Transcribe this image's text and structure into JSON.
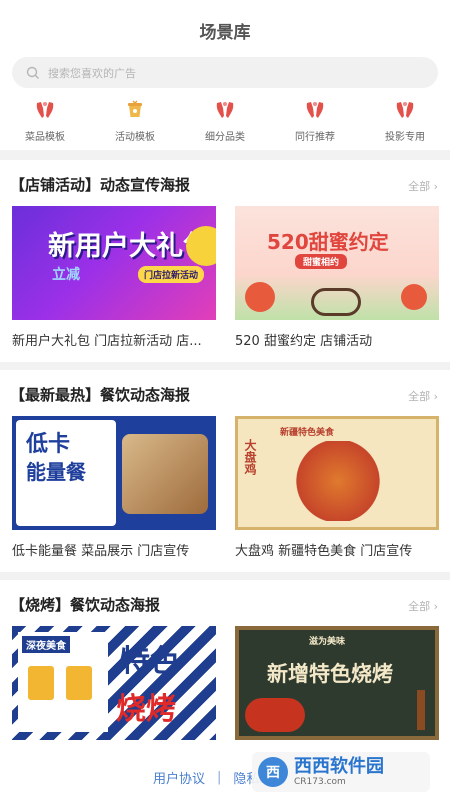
{
  "header": {
    "title": "场景库"
  },
  "search": {
    "placeholder": "搜索您喜欢的广告",
    "icon": "search-icon"
  },
  "categories": [
    {
      "label": "菜品模板",
      "icon": "hands-icon",
      "color": "#e4514a"
    },
    {
      "label": "活动模板",
      "icon": "cup-icon",
      "color": "#e8a23a"
    },
    {
      "label": "细分品类",
      "icon": "hands-icon",
      "color": "#e4514a"
    },
    {
      "label": "同行推荐",
      "icon": "hands-icon",
      "color": "#e4514a"
    },
    {
      "label": "投影专用",
      "icon": "hands-icon",
      "color": "#e4514a"
    }
  ],
  "sections": [
    {
      "title": "【店铺活动】动态宣传海报",
      "more": "全部",
      "cards": [
        {
          "caption": "新用户大礼包 门店拉新活动 店...",
          "poster_text": "新用户大礼包",
          "poster_sub": "立减",
          "poster_badge": "门店拉新活动"
        },
        {
          "caption": "520 甜蜜约定 店铺活动",
          "poster_text": "520甜蜜约定",
          "poster_sub": "甜蜜相约"
        }
      ]
    },
    {
      "title": "【最新最热】餐饮动态海报",
      "more": "全部",
      "cards": [
        {
          "caption": "低卡能量餐 菜品展示 门店宣传",
          "poster_text": "低卡",
          "poster_sub": "能量餐"
        },
        {
          "caption": "大盘鸡 新疆特色美食 门店宣传",
          "poster_text": "新疆特色美食",
          "poster_sub": "大盘鸡"
        }
      ]
    },
    {
      "title": "【烧烤】餐饮动态海报",
      "more": "全部",
      "cards": [
        {
          "caption": "",
          "poster_text": "特色",
          "poster_sub": "烧烤",
          "poster_badge": "深夜美食"
        },
        {
          "caption": "",
          "poster_text": "新增特色烧烤",
          "poster_sub": "滋为美味"
        }
      ]
    }
  ],
  "footer": {
    "user_agreement": "用户协议",
    "separator": "|",
    "privacy": "隐私政策"
  },
  "watermark": {
    "logo": "西",
    "name": "西西软件园",
    "url": "CR173.com"
  }
}
